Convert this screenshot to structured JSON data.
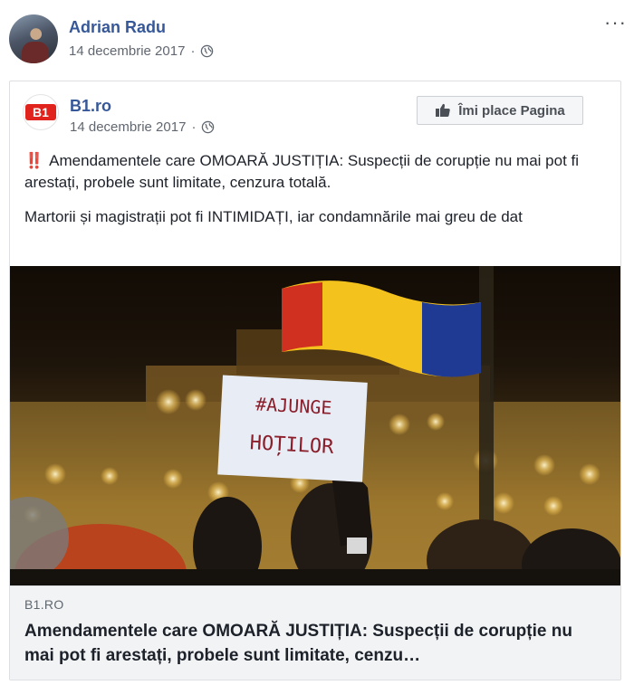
{
  "post": {
    "author": "Adrian Radu",
    "date": "14 decembrie 2017",
    "separator": "·",
    "more_label": "···",
    "privacy_icon": "globe-icon"
  },
  "shared_post": {
    "page_name": "B1.ro",
    "date": "14 decembrie 2017",
    "separator": "·",
    "like_button_label": "Îmi place Pagina",
    "logo_text": "B1",
    "emoji": "‼️",
    "text_paragraph_1": "Amendamentele care OMOARĂ JUSTIȚIA: Suspecții de corupție nu mai pot fi arestați, probele sunt limitate, cenzura totală.",
    "text_paragraph_2": "Martorii și magistrații pot fi INTIMIDAȚI, iar condamnările mai greu de dat"
  },
  "link_card": {
    "image_sign_line_1": "#AJUNGE",
    "image_sign_line_2": "HOȚILOR",
    "domain": "B1.RO",
    "title": "Amendamentele care OMOARĂ JUSTIȚIA: Suspecții de corupție nu mai pot fi arestați, probele sunt limitate, cenzu…"
  },
  "colors": {
    "link_blue": "#365899",
    "text": "#1d2129",
    "meta_gray": "#616770",
    "logo_red": "#e0231c",
    "flag_blue": "#1f3a93",
    "flag_yellow": "#f4c21c",
    "flag_red": "#d0301f"
  }
}
